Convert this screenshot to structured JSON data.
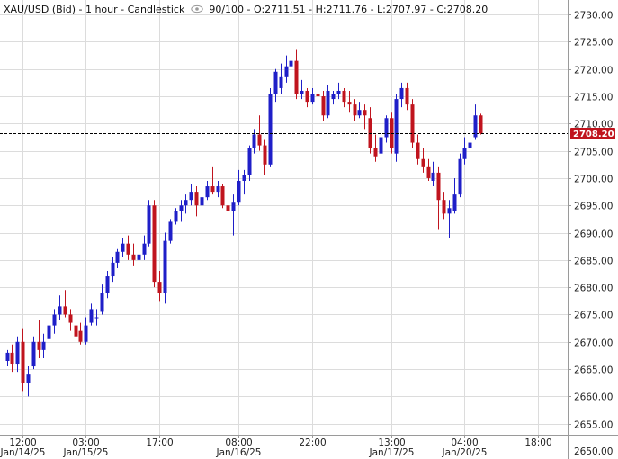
{
  "header": {
    "symbol": "XAU/USD (Bid) - 1 hour - Candlestick",
    "eye_icon": "eye-icon",
    "zoom": "90/100",
    "ohlc": "- O:2711.51 - H:2711.76 - L:2707.97 - C:2708.20"
  },
  "colors": {
    "up": "#1f1fc8",
    "down": "#c0141e",
    "grid": "#dcdcdc",
    "last": "#c0141e"
  },
  "chart_data": {
    "type": "candlestick",
    "ylim": [
      2650,
      2732
    ],
    "yticks": [
      2655,
      2660,
      2665,
      2670,
      2675,
      2680,
      2685,
      2690,
      2695,
      2700,
      2705,
      2710,
      2715,
      2720,
      2725,
      2730
    ],
    "ytick_labels": [
      "2655.00",
      "2660.00",
      "2665.00",
      "2670.00",
      "2675.00",
      "2680.00",
      "2685.00",
      "2690.00",
      "2695.00",
      "2700.00",
      "2705.00",
      "2710.00",
      "2715.00",
      "2720.00",
      "2725.00",
      "2730.00"
    ],
    "ylabel_cut": "2650.00",
    "last_price": 2708.2,
    "last_price_label": "2708.20",
    "xticks": [
      {
        "i": 3,
        "time": "12:00",
        "date": "Jan/14/25"
      },
      {
        "i": 15,
        "time": "03:00",
        "date": "Jan/15/25"
      },
      {
        "i": 29,
        "time": "17:00",
        "date": ""
      },
      {
        "i": 44,
        "time": "08:00",
        "date": "Jan/16/25"
      },
      {
        "i": 58,
        "time": "22:00",
        "date": ""
      },
      {
        "i": 73,
        "time": "13:00",
        "date": "Jan/17/25"
      },
      {
        "i": 87,
        "time": "04:00",
        "date": "Jan/20/25"
      },
      {
        "i": 101,
        "time": "18:00",
        "date": ""
      }
    ],
    "candles": [
      [
        2666.5,
        2668.5,
        2665.5,
        2668.0
      ],
      [
        2668.0,
        2669.5,
        2664.5,
        2666.0
      ],
      [
        2666.0,
        2671.0,
        2664.5,
        2670.0
      ],
      [
        2670.0,
        2672.5,
        2661.0,
        2662.5
      ],
      [
        2662.5,
        2665.5,
        2660.0,
        2664.0
      ],
      [
        2665.5,
        2671.0,
        2665.0,
        2670.0
      ],
      [
        2670.0,
        2674.0,
        2667.0,
        2668.5
      ],
      [
        2668.5,
        2671.5,
        2667.0,
        2670.0
      ],
      [
        2670.5,
        2674.0,
        2669.5,
        2673.0
      ],
      [
        2673.0,
        2676.0,
        2671.5,
        2675.0
      ],
      [
        2675.0,
        2678.5,
        2674.0,
        2676.5
      ],
      [
        2676.5,
        2679.5,
        2674.5,
        2675.0
      ],
      [
        2675.0,
        2676.0,
        2672.0,
        2673.5
      ],
      [
        2673.0,
        2675.0,
        2670.0,
        2671.0
      ],
      [
        2672.0,
        2673.5,
        2669.5,
        2670.0
      ],
      [
        2670.0,
        2674.5,
        2669.5,
        2673.0
      ],
      [
        2673.5,
        2677.0,
        2673.0,
        2676.0
      ],
      [
        2674.5,
        2676.0,
        2673.0,
        2674.5
      ],
      [
        2675.5,
        2680.5,
        2675.0,
        2679.0
      ],
      [
        2679.0,
        2683.0,
        2678.0,
        2682.0
      ],
      [
        2682.0,
        2685.5,
        2681.0,
        2684.5
      ],
      [
        2684.5,
        2687.0,
        2683.5,
        2686.5
      ],
      [
        2686.5,
        2689.0,
        2685.5,
        2688.0
      ],
      [
        2688.0,
        2689.5,
        2685.0,
        2686.0
      ],
      [
        2686.0,
        2688.0,
        2684.0,
        2685.0
      ],
      [
        2685.0,
        2687.0,
        2683.0,
        2686.0
      ],
      [
        2686.0,
        2689.5,
        2685.0,
        2688.0
      ],
      [
        2688.0,
        2696.0,
        2687.5,
        2695.0
      ],
      [
        2695.0,
        2696.0,
        2680.0,
        2681.0
      ],
      [
        2681.0,
        2683.0,
        2677.5,
        2679.0
      ],
      [
        2679.0,
        2690.0,
        2677.0,
        2688.5
      ],
      [
        2688.5,
        2692.5,
        2688.0,
        2692.0
      ],
      [
        2692.0,
        2694.5,
        2691.5,
        2694.0
      ],
      [
        2694.0,
        2696.0,
        2692.0,
        2695.0
      ],
      [
        2695.0,
        2697.0,
        2693.5,
        2696.0
      ],
      [
        2696.0,
        2699.0,
        2695.0,
        2697.5
      ],
      [
        2697.5,
        2698.5,
        2693.0,
        2695.0
      ],
      [
        2695.0,
        2697.0,
        2693.5,
        2696.5
      ],
      [
        2696.5,
        2699.5,
        2696.0,
        2698.5
      ],
      [
        2698.5,
        2702.0,
        2697.0,
        2697.5
      ],
      [
        2697.5,
        2699.5,
        2696.5,
        2698.5
      ],
      [
        2698.5,
        2699.0,
        2694.5,
        2695.0
      ],
      [
        2695.0,
        2698.0,
        2693.0,
        2694.0
      ],
      [
        2694.0,
        2697.0,
        2689.5,
        2695.5
      ],
      [
        2695.5,
        2701.5,
        2695.0,
        2699.5
      ],
      [
        2699.5,
        2701.5,
        2697.0,
        2700.5
      ],
      [
        2700.5,
        2706.0,
        2699.5,
        2705.5
      ],
      [
        2705.5,
        2709.0,
        2704.5,
        2708.0
      ],
      [
        2708.0,
        2711.5,
        2705.0,
        2706.0
      ],
      [
        2706.0,
        2707.0,
        2700.5,
        2702.5
      ],
      [
        2702.5,
        2716.5,
        2702.0,
        2715.5
      ],
      [
        2715.5,
        2720.0,
        2714.0,
        2719.5
      ],
      [
        2716.5,
        2721.0,
        2715.5,
        2718.5
      ],
      [
        2718.5,
        2722.5,
        2717.5,
        2720.5
      ],
      [
        2720.5,
        2724.5,
        2719.0,
        2721.5
      ],
      [
        2721.5,
        2723.5,
        2714.5,
        2715.5
      ],
      [
        2715.5,
        2718.0,
        2714.5,
        2716.0
      ],
      [
        2716.0,
        2716.5,
        2713.0,
        2714.0
      ],
      [
        2714.0,
        2716.5,
        2713.5,
        2715.5
      ],
      [
        2715.5,
        2716.5,
        2714.0,
        2715.0
      ],
      [
        2715.0,
        2716.0,
        2710.5,
        2711.5
      ],
      [
        2711.5,
        2717.0,
        2711.0,
        2716.0
      ],
      [
        2714.5,
        2716.0,
        2713.5,
        2715.5
      ],
      [
        2715.5,
        2717.5,
        2714.5,
        2716.0
      ],
      [
        2716.0,
        2716.5,
        2713.0,
        2714.0
      ],
      [
        2714.0,
        2716.0,
        2712.0,
        2713.5
      ],
      [
        2713.5,
        2714.5,
        2710.5,
        2711.5
      ],
      [
        2711.5,
        2714.0,
        2711.0,
        2712.5
      ],
      [
        2712.5,
        2713.5,
        2709.0,
        2711.5
      ],
      [
        2711.0,
        2713.0,
        2704.5,
        2705.5
      ],
      [
        2705.5,
        2708.0,
        2703.0,
        2704.0
      ],
      [
        2704.5,
        2708.5,
        2704.0,
        2707.5
      ],
      [
        2707.5,
        2711.5,
        2706.5,
        2711.0
      ],
      [
        2711.0,
        2712.0,
        2704.5,
        2705.5
      ],
      [
        2704.5,
        2715.5,
        2703.0,
        2714.5
      ],
      [
        2714.5,
        2717.5,
        2713.0,
        2716.5
      ],
      [
        2716.5,
        2717.5,
        2712.5,
        2713.5
      ],
      [
        2713.5,
        2714.5,
        2705.5,
        2706.5
      ],
      [
        2706.5,
        2708.0,
        2702.5,
        2703.5
      ],
      [
        2703.5,
        2705.5,
        2701.0,
        2702.0
      ],
      [
        2702.0,
        2703.5,
        2699.5,
        2700.0
      ],
      [
        2699.5,
        2703.0,
        2698.5,
        2701.0
      ],
      [
        2701.0,
        2702.0,
        2690.5,
        2696.0
      ],
      [
        2696.0,
        2697.5,
        2692.5,
        2693.5
      ],
      [
        2693.5,
        2696.0,
        2689.0,
        2694.5
      ],
      [
        2694.0,
        2700.0,
        2693.5,
        2697.0
      ],
      [
        2697.0,
        2704.5,
        2696.5,
        2703.5
      ],
      [
        2703.5,
        2707.5,
        2702.5,
        2705.5
      ],
      [
        2705.5,
        2707.5,
        2703.5,
        2706.5
      ],
      [
        2707.5,
        2713.5,
        2707.0,
        2711.5
      ],
      [
        2711.5,
        2711.8,
        2708.0,
        2708.2
      ]
    ]
  }
}
